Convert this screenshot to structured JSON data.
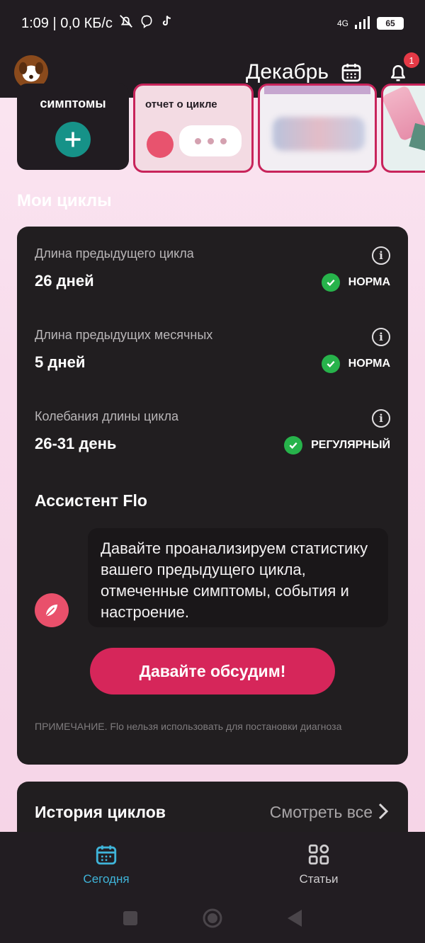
{
  "status_bar": {
    "time_text": "1:09 | 0,0 КБ/с",
    "network": "4G",
    "battery": "65"
  },
  "header": {
    "month": "Декабрь",
    "notification_count": "1"
  },
  "stories": {
    "symptoms_label": "симптомы",
    "report_label": "отчет о цикле"
  },
  "section_title": "Мои циклы",
  "cycle_stats": [
    {
      "label": "Длина предыдущего цикла",
      "value": "26 дней",
      "status": "НОРМА"
    },
    {
      "label": "Длина предыдущих месячных",
      "value": "5 дней",
      "status": "НОРМА"
    },
    {
      "label": "Колебания длины цикла",
      "value": "26-31 день",
      "status": "РЕГУЛЯРНЫЙ"
    }
  ],
  "assistant": {
    "title": "Ассистент Flo",
    "message": "Давайте проанализируем статистику вашего предыдущего цикла, отмеченные симптомы, события и настроение.",
    "cta": "Давайте обсудим!",
    "note": "ПРИМЕЧАНИЕ. Flo нельзя использовать для постановки диагноза"
  },
  "history": {
    "title": "История циклов",
    "see_all": "Смотреть все"
  },
  "bottom_nav": {
    "today": "Сегодня",
    "articles": "Статьи"
  },
  "colors": {
    "accent": "#d6265a",
    "teal": "#169288",
    "nav_active": "#3fb4d9",
    "ok_green": "#27b34b"
  }
}
